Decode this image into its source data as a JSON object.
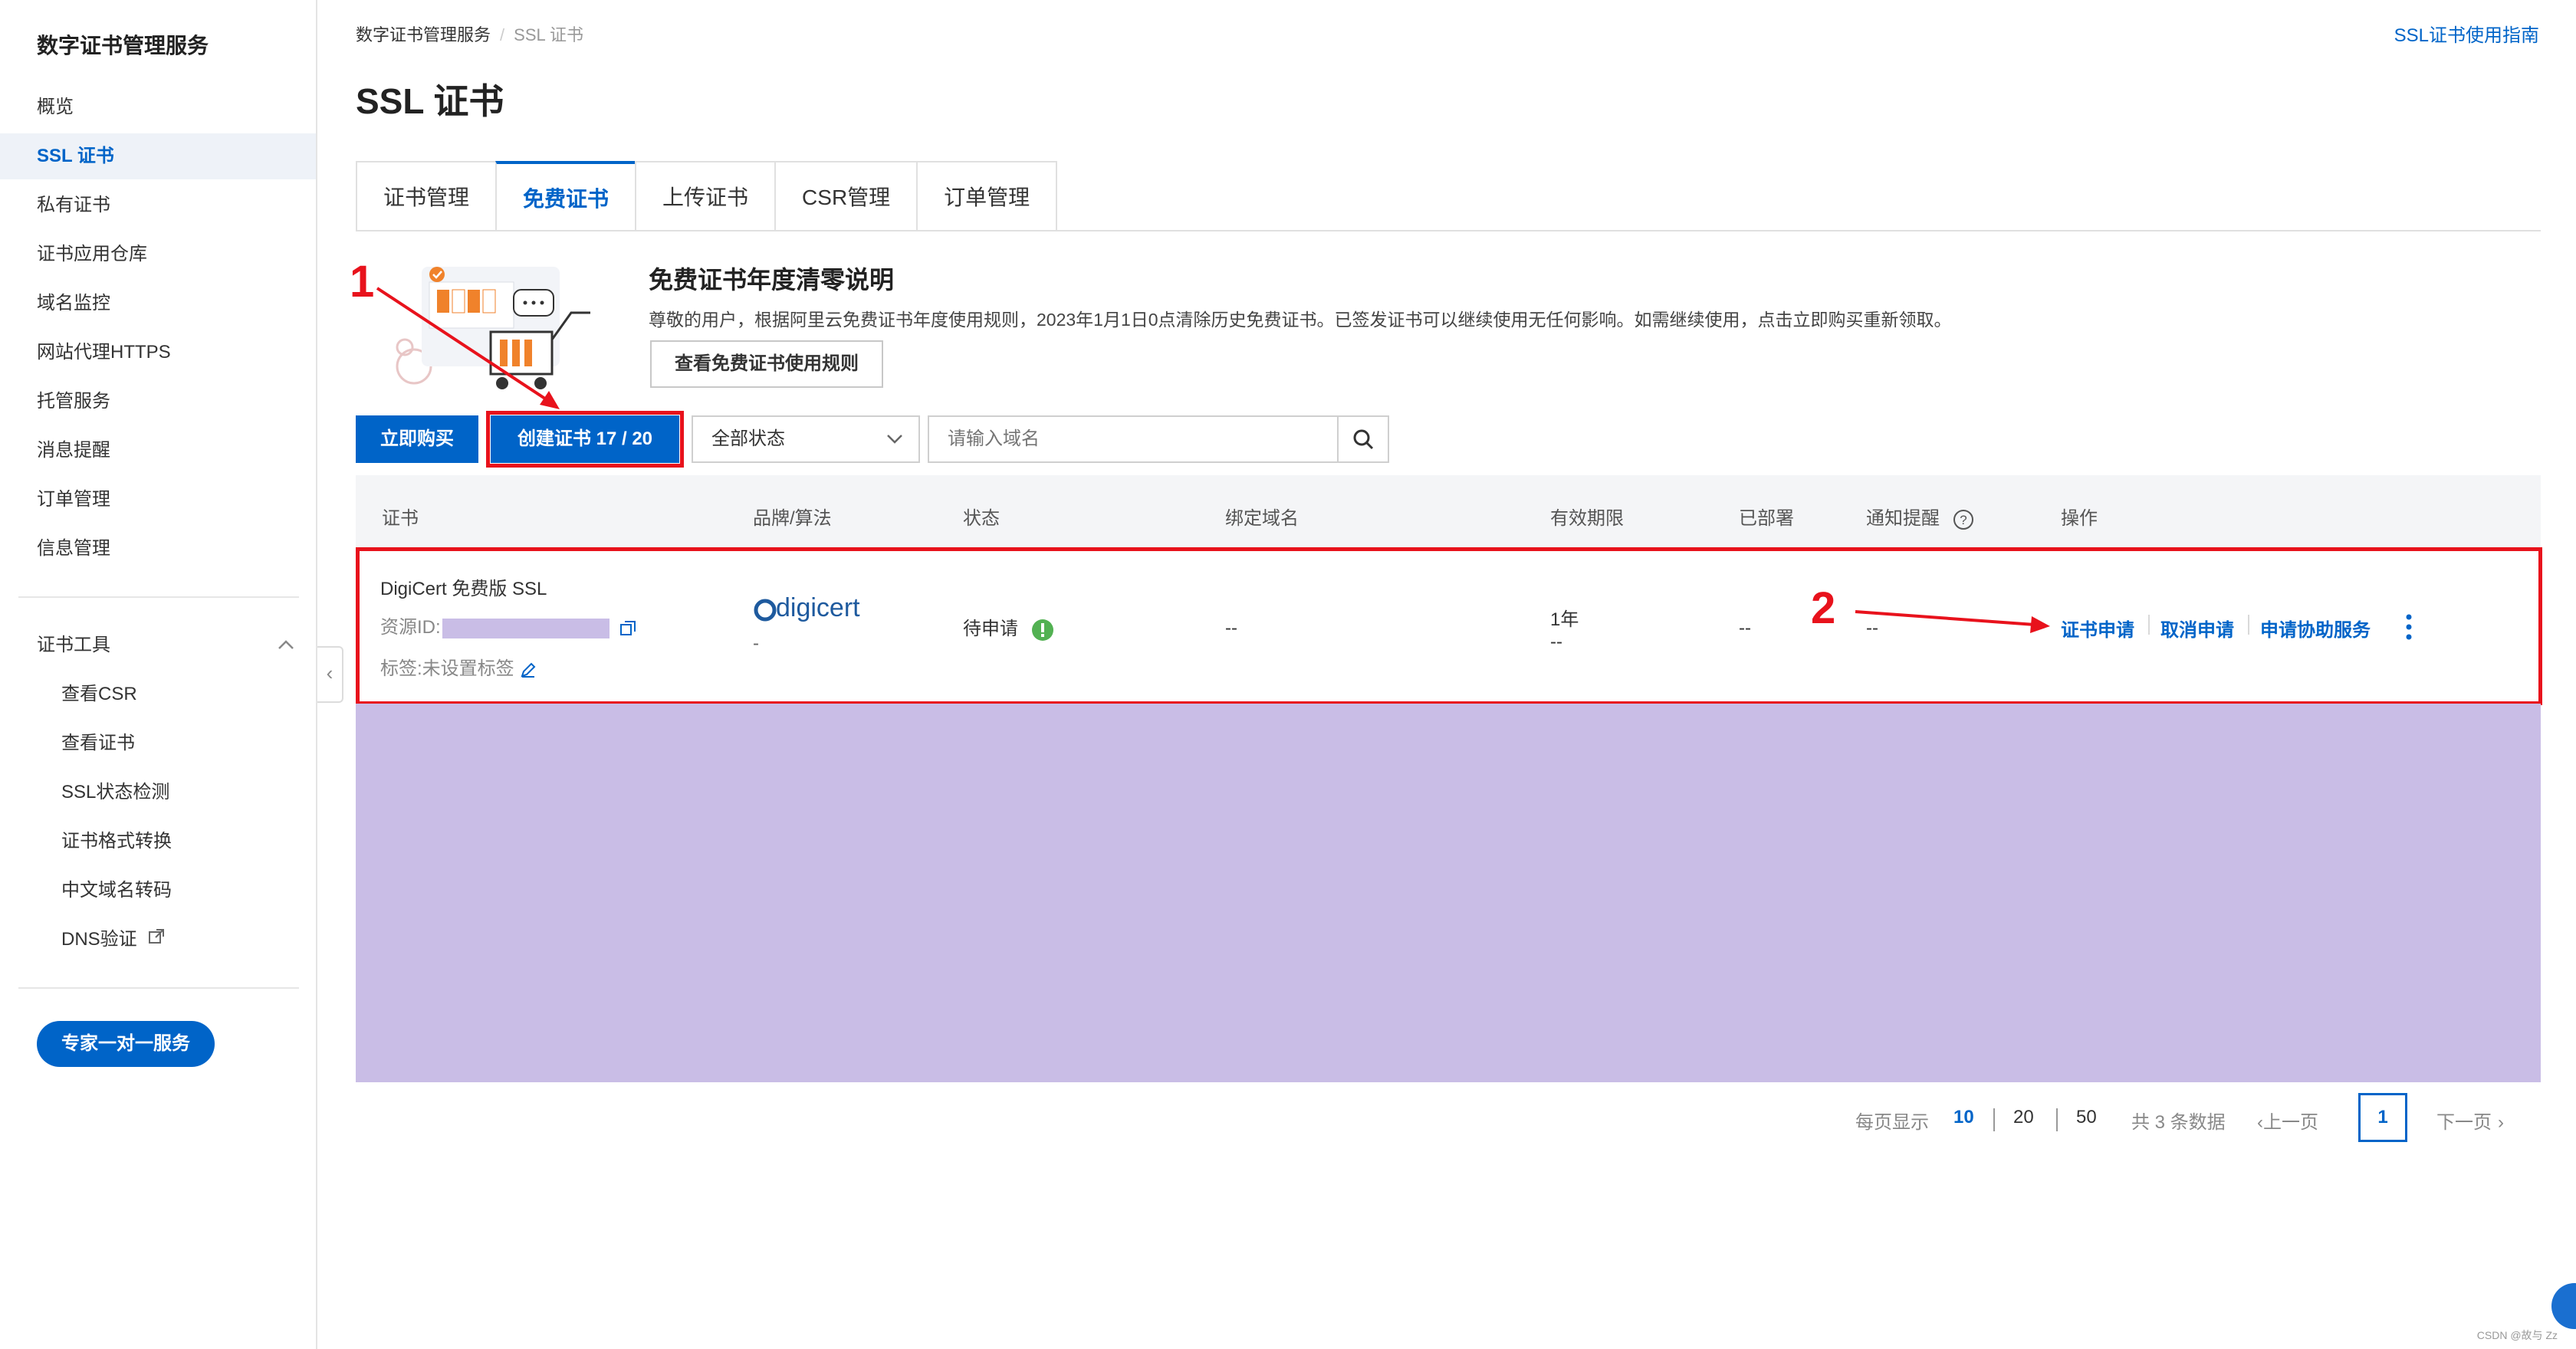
{
  "sidebar": {
    "title": "数字证书管理服务",
    "items": [
      "概览",
      "SSL 证书",
      "私有证书",
      "证书应用仓库",
      "域名监控",
      "网站代理HTTPS",
      "托管服务",
      "消息提醒",
      "订单管理",
      "信息管理"
    ],
    "tools_header": "证书工具",
    "tools": [
      "查看CSR",
      "查看证书",
      "SSL状态检测",
      "证书格式转换",
      "中文域名转码",
      "DNS验证"
    ],
    "expert_button": "专家一对一服务"
  },
  "header": {
    "breadcrumb": [
      "数字证书管理服务",
      "SSL 证书"
    ],
    "guide_link": "SSL证书使用指南",
    "page_title": "SSL 证书"
  },
  "tabs": [
    "证书管理",
    "免费证书",
    "上传证书",
    "CSR管理",
    "订单管理"
  ],
  "notice": {
    "title": "免费证书年度清零说明",
    "text": "尊敬的用户，根据阿里云免费证书年度使用规则，2023年1月1日0点清除历史免费证书。已签发证书可以继续使用无任何影响。如需继续使用，点击立即购买重新领取。",
    "button": "查看免费证书使用规则"
  },
  "toolbar": {
    "buy_button": "立即购买",
    "create_button": "创建证书 17 / 20",
    "status_select": "全部状态",
    "search_placeholder": "请输入域名"
  },
  "table": {
    "headers": [
      "证书",
      "品牌/算法",
      "状态",
      "绑定域名",
      "有效期限",
      "已部署",
      "通知提醒",
      "操作"
    ],
    "row": {
      "name": "DigiCert 免费版 SSL",
      "resource_label": "资源ID:",
      "tag": "标签:未设置标签",
      "brand": "digicert",
      "brand_sub": "-",
      "status": "待申请",
      "domain": "--",
      "validity": "1年",
      "validity_sub": "--",
      "deployed": "--",
      "notify": "--",
      "actions": [
        "证书申请",
        "取消申请",
        "申请协助服务"
      ]
    }
  },
  "annotations": {
    "marker1": "1",
    "marker2": "2"
  },
  "pagination": {
    "per_page_label": "每页显示",
    "sizes": [
      "10",
      "20",
      "50"
    ],
    "total": "共 3 条数据",
    "prev": "上一页",
    "current": "1",
    "next": "下一页"
  },
  "watermark": "CSDN @故与 Zz",
  "colors": {
    "primary": "#0064c8",
    "highlight_red": "#e8121c",
    "status_green": "#52b152",
    "mask_purple": "#c9bde6"
  }
}
